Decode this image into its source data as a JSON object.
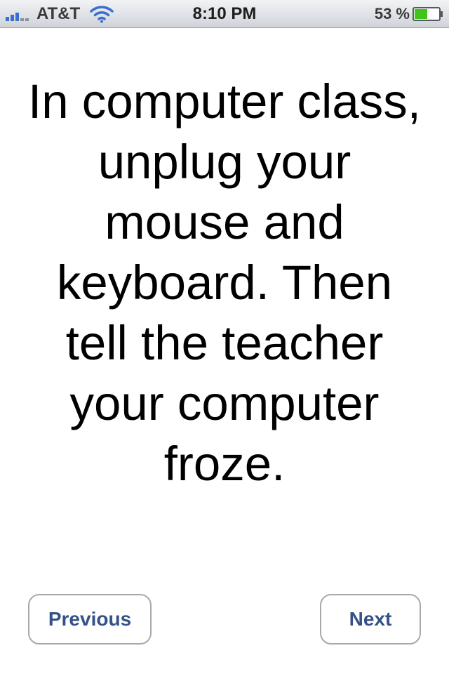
{
  "status_bar": {
    "carrier": "AT&T",
    "time": "8:10 PM",
    "battery_percent": "53 %",
    "battery_level": 0.53,
    "signal_icon": "signal-bars-icon",
    "wifi_icon": "wifi-icon",
    "battery_icon": "battery-icon"
  },
  "content": {
    "message": "In computer class, unplug your mouse and keyboard. Then tell the teacher your computer froze."
  },
  "navigation": {
    "previous_label": "Previous",
    "next_label": "Next"
  },
  "colors": {
    "button_text": "#35518a",
    "button_border": "#a9a9a9",
    "battery_fill": "#3ec41b"
  }
}
